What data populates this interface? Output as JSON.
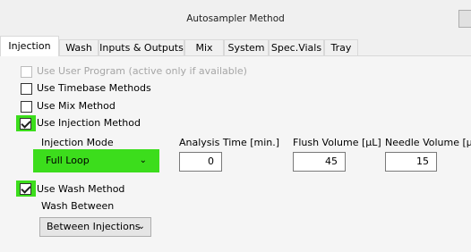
{
  "window": {
    "title": "Autosampler Method"
  },
  "tabs": [
    {
      "label": "Injection",
      "active": true
    },
    {
      "label": "Wash"
    },
    {
      "label": "Inputs & Outputs"
    },
    {
      "label": "Mix"
    },
    {
      "label": "System"
    },
    {
      "label": "Spec.Vials"
    },
    {
      "label": "Tray"
    }
  ],
  "options": {
    "user_program": {
      "label": "Use User Program (active only if available)",
      "checked": false,
      "enabled": false
    },
    "timebase": {
      "label": "Use Timebase Methods",
      "checked": false
    },
    "mix": {
      "label": "Use Mix Method",
      "checked": false
    },
    "injection": {
      "label": "Use Injection Method",
      "checked": true
    },
    "wash": {
      "label": "Use Wash Method",
      "checked": true
    }
  },
  "injection": {
    "mode_label": "Injection Mode",
    "mode_value": "Full Loop",
    "analysis_time_label": "Analysis Time [min.]",
    "analysis_time_value": "0",
    "flush_volume_label": "Flush Volume [µL]",
    "flush_volume_value": "45",
    "needle_volume_label": "Needle Volume [µL]",
    "needle_volume_value": "15"
  },
  "wash": {
    "between_label": "Wash Between",
    "between_value": "Between Injections"
  },
  "colors": {
    "highlight": "#3cdd1c"
  }
}
